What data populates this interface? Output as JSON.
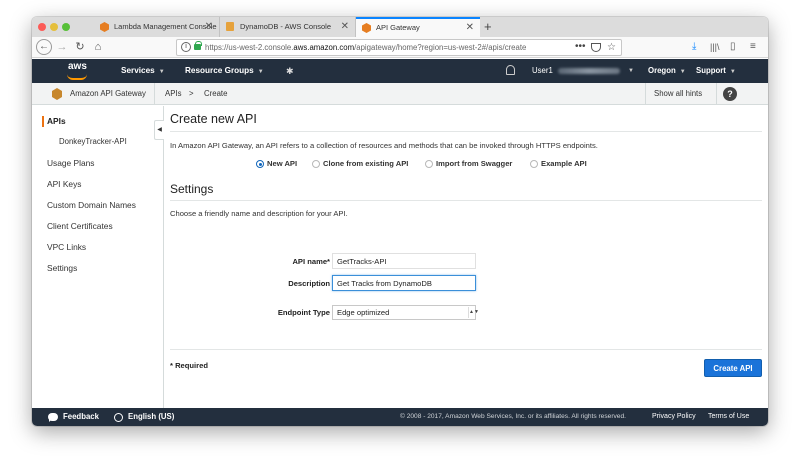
{
  "browser": {
    "tabs": [
      {
        "title": "Lambda Management Console",
        "active": false
      },
      {
        "title": "DynamoDB - AWS Console",
        "active": false
      },
      {
        "title": "API Gateway",
        "active": true
      }
    ],
    "new_tab": "+",
    "url_prefix": "https://us-west-2.console.",
    "url_domain": "aws.amazon.com",
    "url_rest": "/apigateway/home?region=us-west-2#/apis/create",
    "url_more": "•••"
  },
  "awsnav": {
    "logo": "aws",
    "services": "Services",
    "resource_groups": "Resource Groups",
    "user": "User1",
    "region": "Oregon",
    "support": "Support"
  },
  "svcbar": {
    "service": "Amazon API Gateway",
    "crumbs": [
      "APIs",
      ">",
      "Create"
    ],
    "hints": "Show all hints",
    "help": "?"
  },
  "sidebar": {
    "items": [
      "APIs",
      "DonkeyTracker-API",
      "Usage Plans",
      "API Keys",
      "Custom Domain Names",
      "Client Certificates",
      "VPC Links",
      "Settings"
    ]
  },
  "main": {
    "title": "Create new API",
    "intro": "In Amazon API Gateway, an API refers to a collection of resources and methods that can be invoked through HTTPS endpoints.",
    "options": [
      "New API",
      "Clone from existing API",
      "Import from Swagger",
      "Example API"
    ],
    "selected_option": "New API",
    "settings_title": "Settings",
    "settings_intro": "Choose a friendly name and description for your API.",
    "api_name_label": "API name*",
    "api_name_value": "GetTracks-API",
    "description_label": "Description",
    "description_value": "Get Tracks from DynamoDB",
    "endpoint_label": "Endpoint Type",
    "endpoint_value": "Edge optimized",
    "required": "* Required",
    "create_button": "Create API"
  },
  "footer": {
    "feedback": "Feedback",
    "language": "English (US)",
    "copyright": "© 2008 - 2017, Amazon Web Services, Inc. or its affiliates. All rights reserved.",
    "privacy": "Privacy Policy",
    "terms": "Terms of Use"
  },
  "colors": {
    "aws_nav": "#232f3e",
    "aws_orange": "#ff9900",
    "primary_button": "#1a73d9",
    "tab_accent": "#0a84ff"
  },
  "icons": {
    "close": "✕",
    "caret": "▼",
    "back": "←",
    "forward": "→",
    "reload": "↻",
    "home": "⌂",
    "star": "☆",
    "download": "⤓",
    "library": "|||\\",
    "sidebar": "▯",
    "menu": "≡",
    "pin": "✱",
    "collapse": "◀"
  }
}
